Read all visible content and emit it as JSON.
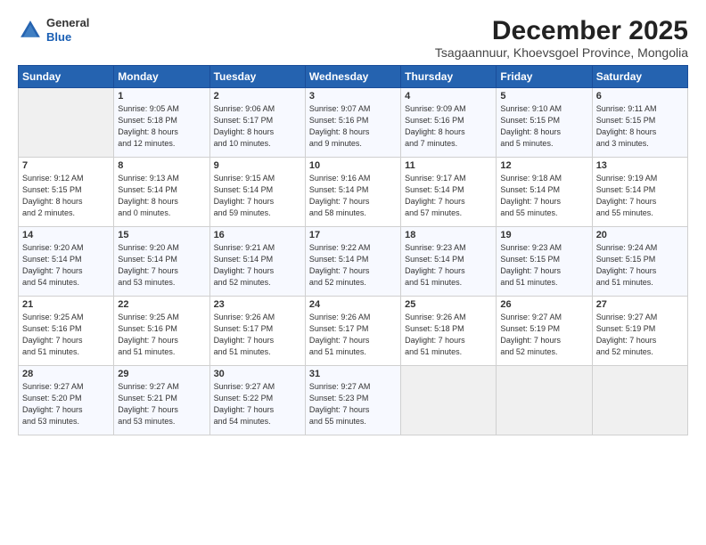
{
  "logo": {
    "line1": "General",
    "line2": "Blue"
  },
  "title": "December 2025",
  "subtitle": "Tsagaannuur, Khoevsgoel Province, Mongolia",
  "days_of_week": [
    "Sunday",
    "Monday",
    "Tuesday",
    "Wednesday",
    "Thursday",
    "Friday",
    "Saturday"
  ],
  "weeks": [
    [
      {
        "day": "",
        "info": ""
      },
      {
        "day": "1",
        "info": "Sunrise: 9:05 AM\nSunset: 5:18 PM\nDaylight: 8 hours\nand 12 minutes."
      },
      {
        "day": "2",
        "info": "Sunrise: 9:06 AM\nSunset: 5:17 PM\nDaylight: 8 hours\nand 10 minutes."
      },
      {
        "day": "3",
        "info": "Sunrise: 9:07 AM\nSunset: 5:16 PM\nDaylight: 8 hours\nand 9 minutes."
      },
      {
        "day": "4",
        "info": "Sunrise: 9:09 AM\nSunset: 5:16 PM\nDaylight: 8 hours\nand 7 minutes."
      },
      {
        "day": "5",
        "info": "Sunrise: 9:10 AM\nSunset: 5:15 PM\nDaylight: 8 hours\nand 5 minutes."
      },
      {
        "day": "6",
        "info": "Sunrise: 9:11 AM\nSunset: 5:15 PM\nDaylight: 8 hours\nand 3 minutes."
      }
    ],
    [
      {
        "day": "7",
        "info": "Sunrise: 9:12 AM\nSunset: 5:15 PM\nDaylight: 8 hours\nand 2 minutes."
      },
      {
        "day": "8",
        "info": "Sunrise: 9:13 AM\nSunset: 5:14 PM\nDaylight: 8 hours\nand 0 minutes."
      },
      {
        "day": "9",
        "info": "Sunrise: 9:15 AM\nSunset: 5:14 PM\nDaylight: 7 hours\nand 59 minutes."
      },
      {
        "day": "10",
        "info": "Sunrise: 9:16 AM\nSunset: 5:14 PM\nDaylight: 7 hours\nand 58 minutes."
      },
      {
        "day": "11",
        "info": "Sunrise: 9:17 AM\nSunset: 5:14 PM\nDaylight: 7 hours\nand 57 minutes."
      },
      {
        "day": "12",
        "info": "Sunrise: 9:18 AM\nSunset: 5:14 PM\nDaylight: 7 hours\nand 55 minutes."
      },
      {
        "day": "13",
        "info": "Sunrise: 9:19 AM\nSunset: 5:14 PM\nDaylight: 7 hours\nand 55 minutes."
      }
    ],
    [
      {
        "day": "14",
        "info": "Sunrise: 9:20 AM\nSunset: 5:14 PM\nDaylight: 7 hours\nand 54 minutes."
      },
      {
        "day": "15",
        "info": "Sunrise: 9:20 AM\nSunset: 5:14 PM\nDaylight: 7 hours\nand 53 minutes."
      },
      {
        "day": "16",
        "info": "Sunrise: 9:21 AM\nSunset: 5:14 PM\nDaylight: 7 hours\nand 52 minutes."
      },
      {
        "day": "17",
        "info": "Sunrise: 9:22 AM\nSunset: 5:14 PM\nDaylight: 7 hours\nand 52 minutes."
      },
      {
        "day": "18",
        "info": "Sunrise: 9:23 AM\nSunset: 5:14 PM\nDaylight: 7 hours\nand 51 minutes."
      },
      {
        "day": "19",
        "info": "Sunrise: 9:23 AM\nSunset: 5:15 PM\nDaylight: 7 hours\nand 51 minutes."
      },
      {
        "day": "20",
        "info": "Sunrise: 9:24 AM\nSunset: 5:15 PM\nDaylight: 7 hours\nand 51 minutes."
      }
    ],
    [
      {
        "day": "21",
        "info": "Sunrise: 9:25 AM\nSunset: 5:16 PM\nDaylight: 7 hours\nand 51 minutes."
      },
      {
        "day": "22",
        "info": "Sunrise: 9:25 AM\nSunset: 5:16 PM\nDaylight: 7 hours\nand 51 minutes."
      },
      {
        "day": "23",
        "info": "Sunrise: 9:26 AM\nSunset: 5:17 PM\nDaylight: 7 hours\nand 51 minutes."
      },
      {
        "day": "24",
        "info": "Sunrise: 9:26 AM\nSunset: 5:17 PM\nDaylight: 7 hours\nand 51 minutes."
      },
      {
        "day": "25",
        "info": "Sunrise: 9:26 AM\nSunset: 5:18 PM\nDaylight: 7 hours\nand 51 minutes."
      },
      {
        "day": "26",
        "info": "Sunrise: 9:27 AM\nSunset: 5:19 PM\nDaylight: 7 hours\nand 52 minutes."
      },
      {
        "day": "27",
        "info": "Sunrise: 9:27 AM\nSunset: 5:19 PM\nDaylight: 7 hours\nand 52 minutes."
      }
    ],
    [
      {
        "day": "28",
        "info": "Sunrise: 9:27 AM\nSunset: 5:20 PM\nDaylight: 7 hours\nand 53 minutes."
      },
      {
        "day": "29",
        "info": "Sunrise: 9:27 AM\nSunset: 5:21 PM\nDaylight: 7 hours\nand 53 minutes."
      },
      {
        "day": "30",
        "info": "Sunrise: 9:27 AM\nSunset: 5:22 PM\nDaylight: 7 hours\nand 54 minutes."
      },
      {
        "day": "31",
        "info": "Sunrise: 9:27 AM\nSunset: 5:23 PM\nDaylight: 7 hours\nand 55 minutes."
      },
      {
        "day": "",
        "info": ""
      },
      {
        "day": "",
        "info": ""
      },
      {
        "day": "",
        "info": ""
      }
    ]
  ]
}
